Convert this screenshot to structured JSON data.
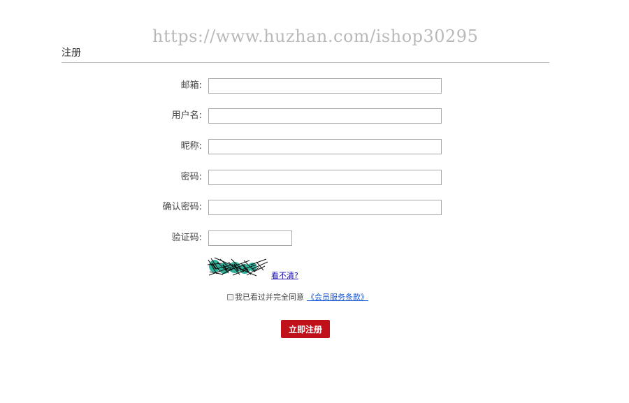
{
  "watermark": "https://www.huzhan.com/ishop30295",
  "page_title": "注册",
  "fields": {
    "email": {
      "label": "邮箱:",
      "value": ""
    },
    "username": {
      "label": "用户名:",
      "value": ""
    },
    "nickname": {
      "label": "昵称:",
      "value": ""
    },
    "password": {
      "label": "密码:",
      "value": ""
    },
    "confirm_password": {
      "label": "确认密码:",
      "value": ""
    },
    "captcha": {
      "label": "验证码:",
      "value": ""
    }
  },
  "captcha_refresh": "看不清?",
  "agreement": {
    "checked": false,
    "text": "我已看过并完全同意",
    "terms_link": "《会员服务条款》"
  },
  "submit_label": "立即注册",
  "colors": {
    "submit_bg": "#c0111a",
    "link": "#1a0dab",
    "divider": "#bdbdbd",
    "captcha_teal": "#2fb39c"
  }
}
